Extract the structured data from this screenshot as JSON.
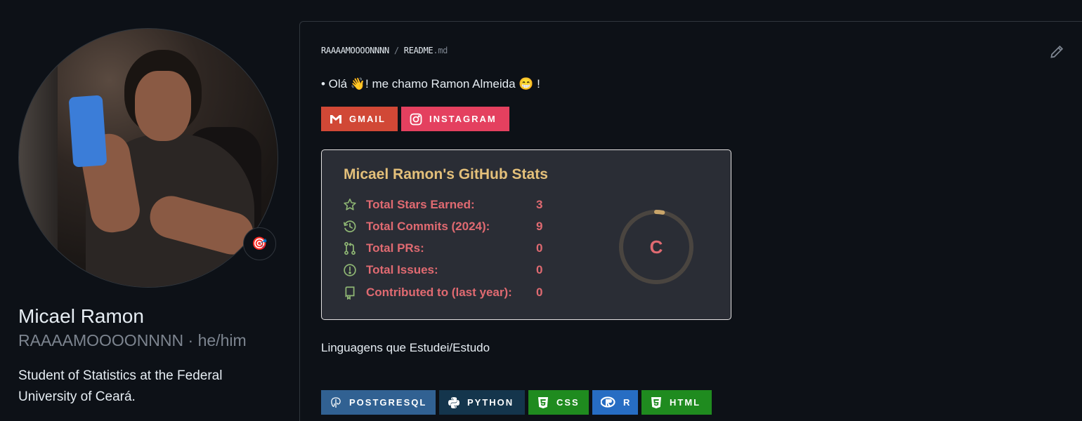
{
  "profile": {
    "name": "Micael Ramon",
    "username": "RAAAAMOOOONNNN",
    "pronouns": "he/him",
    "bio": "Student of Statistics at the Federal University of Ceará.",
    "status_emoji": "🎯"
  },
  "readme": {
    "path_owner": "RAAAAMOOOONNNN",
    "path_sep": "/",
    "path_file": "README",
    "path_ext": ".md",
    "greeting": "• Olá 👋! me chamo Ramon Almeida 😁 !",
    "contact_badges": [
      {
        "label": "GMAIL",
        "color": "#d14836",
        "icon": "gmail-icon"
      },
      {
        "label": "INSTAGRAM",
        "color": "#e4405f",
        "icon": "instagram-icon"
      }
    ],
    "languages_title": "Linguagens que Estudei/Estudo",
    "language_badges": [
      {
        "label": "POSTGRESQL",
        "color": "#316192",
        "icon": "postgresql-icon"
      },
      {
        "label": "PYTHON",
        "color": "#14354c",
        "icon": "python-icon"
      },
      {
        "label": "CSS",
        "color": "#1f8b1f",
        "icon": "css-icon"
      },
      {
        "label": "R",
        "color": "#276dc3",
        "icon": "r-icon"
      },
      {
        "label": "HTML",
        "color": "#1f8b1f",
        "icon": "html-icon"
      }
    ]
  },
  "stats": {
    "title": "Micael Ramon's GitHub Stats",
    "title_color": "#e4c07a",
    "text_color": "#e06a71",
    "icon_color": "#8eb573",
    "rows": [
      {
        "label": "Total Stars Earned:",
        "value": "3",
        "icon": "star-icon"
      },
      {
        "label": "Total Commits (2024):",
        "value": "9",
        "icon": "history-icon"
      },
      {
        "label": "Total PRs:",
        "value": "0",
        "icon": "pull-request-icon"
      },
      {
        "label": "Total Issues:",
        "value": "0",
        "icon": "issue-icon"
      },
      {
        "label": "Contributed to (last year):",
        "value": "0",
        "icon": "repo-icon"
      }
    ],
    "rank": "C",
    "rank_progress": 0.03
  }
}
